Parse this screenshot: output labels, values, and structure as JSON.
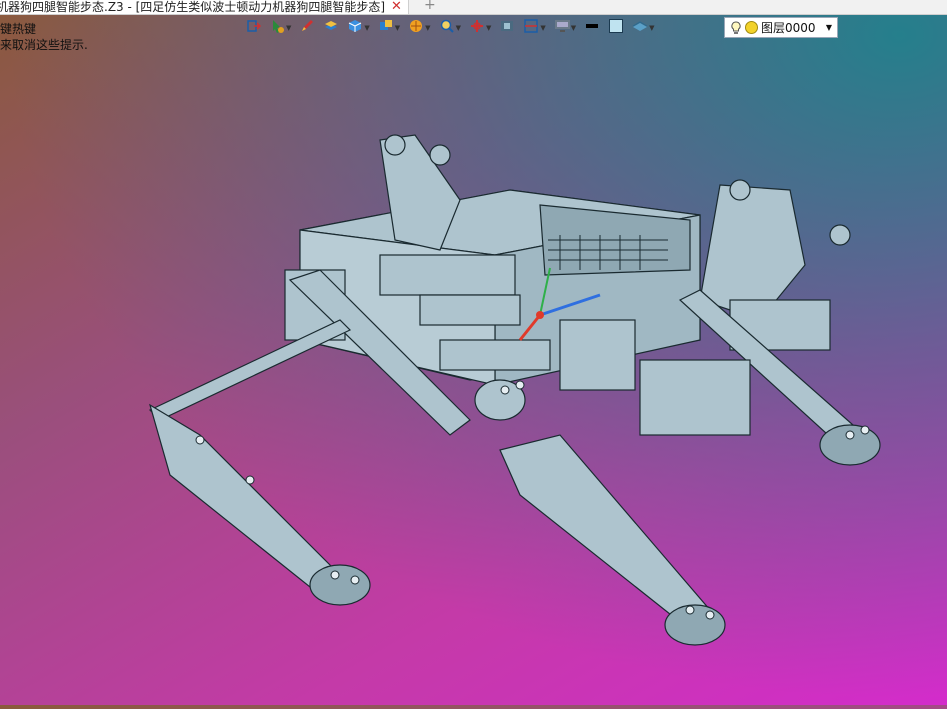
{
  "tabbar": {
    "active_tab": "机器狗四腿智能步态.Z3 - [四足仿生类似波士顿动力机器狗四腿智能步态]",
    "close_symbol": "✕",
    "new_tab_symbol": "+"
  },
  "hints": {
    "line1": "键热键",
    "line2": "来取消这些提示."
  },
  "toolbar": {
    "icons": [
      "exit-icon",
      "select-filter-icon",
      "pen-icon",
      "layer-stack-icon",
      "cube-icon",
      "view-cube-icon",
      "render-ball-icon",
      "zoom-icon",
      "crosshair-icon",
      "camera-icon",
      "clip-icon",
      "monitor-icon",
      "black-line-icon",
      "light-square-icon",
      "plane-icon"
    ]
  },
  "layer": {
    "name": "图层0000",
    "dropdown_symbol": "▼"
  },
  "colors": {
    "model_fill": "#aec4ce",
    "model_stroke": "#1a2a30",
    "axis_x": "#2f6fe0",
    "axis_y": "#2fb04a",
    "axis_z": "#e03a2a"
  }
}
